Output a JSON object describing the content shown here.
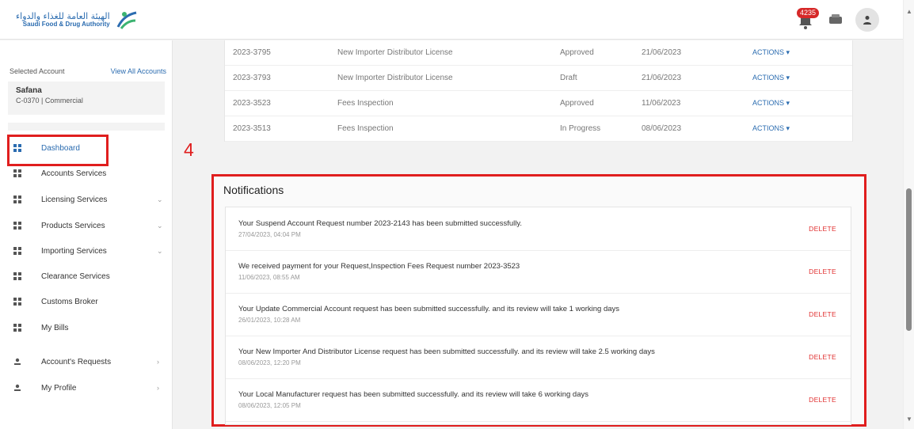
{
  "header": {
    "logo_ar": "الهيئة العامة للغذاء والدواء",
    "logo_en": "Saudi Food & Drug Authority",
    "notification_count": "4235"
  },
  "sidebar": {
    "selected_account_label": "Selected Account",
    "view_all_label": "View All Accounts",
    "account_name": "Safana",
    "account_id": "C-0370",
    "account_type": "Commercial",
    "items": [
      {
        "label": "Dashboard",
        "active": true,
        "chevron": ""
      },
      {
        "label": "Accounts Services",
        "chevron": ""
      },
      {
        "label": "Licensing Services",
        "chevron": "⌄"
      },
      {
        "label": "Products Services",
        "chevron": "⌄"
      },
      {
        "label": "Importing Services",
        "chevron": "⌄"
      },
      {
        "label": "Clearance Services",
        "chevron": ""
      },
      {
        "label": "Customs Broker",
        "chevron": ""
      },
      {
        "label": "My Bills",
        "chevron": ""
      },
      {
        "label": "Account's Requests",
        "chevron": "›"
      },
      {
        "label": "My Profile",
        "chevron": "›"
      }
    ]
  },
  "annotation": {
    "step": "4"
  },
  "requests_table": {
    "rows": [
      {
        "id": "2023-3795",
        "service": "New Importer Distributor License",
        "status": "Approved",
        "date": "21/06/2023",
        "action": "ACTIONS ▾"
      },
      {
        "id": "2023-3793",
        "service": "New Importer Distributor License",
        "status": "Draft",
        "date": "21/06/2023",
        "action": "ACTIONS ▾"
      },
      {
        "id": "2023-3523",
        "service": "Fees Inspection",
        "status": "Approved",
        "date": "11/06/2023",
        "action": "ACTIONS ▾"
      },
      {
        "id": "2023-3513",
        "service": "Fees Inspection",
        "status": "In Progress",
        "date": "08/06/2023",
        "action": "ACTIONS ▾"
      }
    ]
  },
  "notifications": {
    "title": "Notifications",
    "delete_label": "DELETE",
    "items": [
      {
        "message": "Your Suspend Account Request number 2023-2143 has been submitted successfully.",
        "date": "27/04/2023, 04:04 PM"
      },
      {
        "message": "We received payment for your Request,Inspection Fees Request number 2023-3523",
        "date": "11/06/2023, 08:55 AM"
      },
      {
        "message": "Your Update Commercial Account request has been submitted successfully. and its review will take 1 working days",
        "date": "26/01/2023, 10:28 AM"
      },
      {
        "message": "Your New Importer And Distributor License request has been submitted successfully. and its review will take 2.5 working days",
        "date": "08/06/2023, 12:20 PM"
      },
      {
        "message": "Your Local Manufacturer request has been submitted successfully. and its review will take 6 working days",
        "date": "08/06/2023, 12:05 PM"
      }
    ]
  },
  "colors": {
    "accent": "#2b6cb0",
    "highlight": "#e01e1e",
    "delete": "#e03030",
    "badge": "#d62828"
  }
}
